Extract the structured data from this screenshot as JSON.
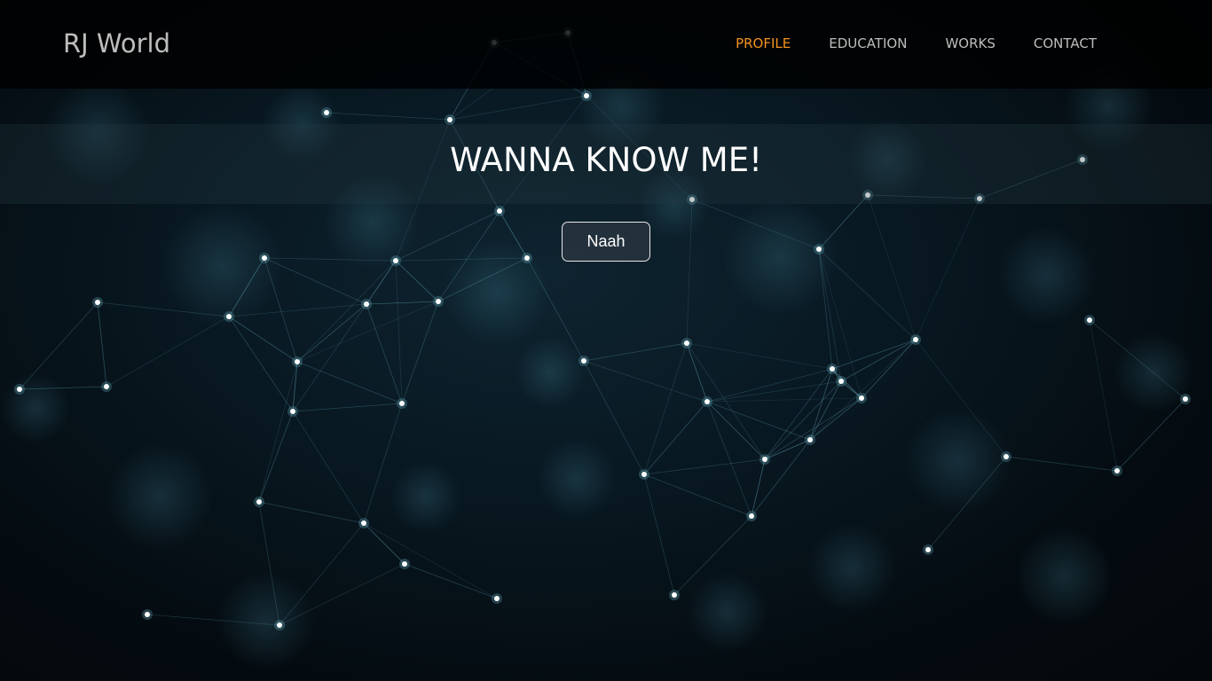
{
  "brand": {
    "name": "RJ World"
  },
  "nav": {
    "items": [
      {
        "label": "PROFILE",
        "active": true
      },
      {
        "label": "EDUCATION",
        "active": false
      },
      {
        "label": "WORKS",
        "active": false
      },
      {
        "label": "CONTACT",
        "active": false
      }
    ]
  },
  "hero": {
    "title": "WANNA KNOW ME!",
    "button_label": "Naah"
  },
  "colors": {
    "accent": "#f5921e",
    "nav_text": "#bdbdbd",
    "network_line": "#7fd3e8",
    "network_node": "#ffffff"
  },
  "background": {
    "image": "plexus-network-icon"
  }
}
